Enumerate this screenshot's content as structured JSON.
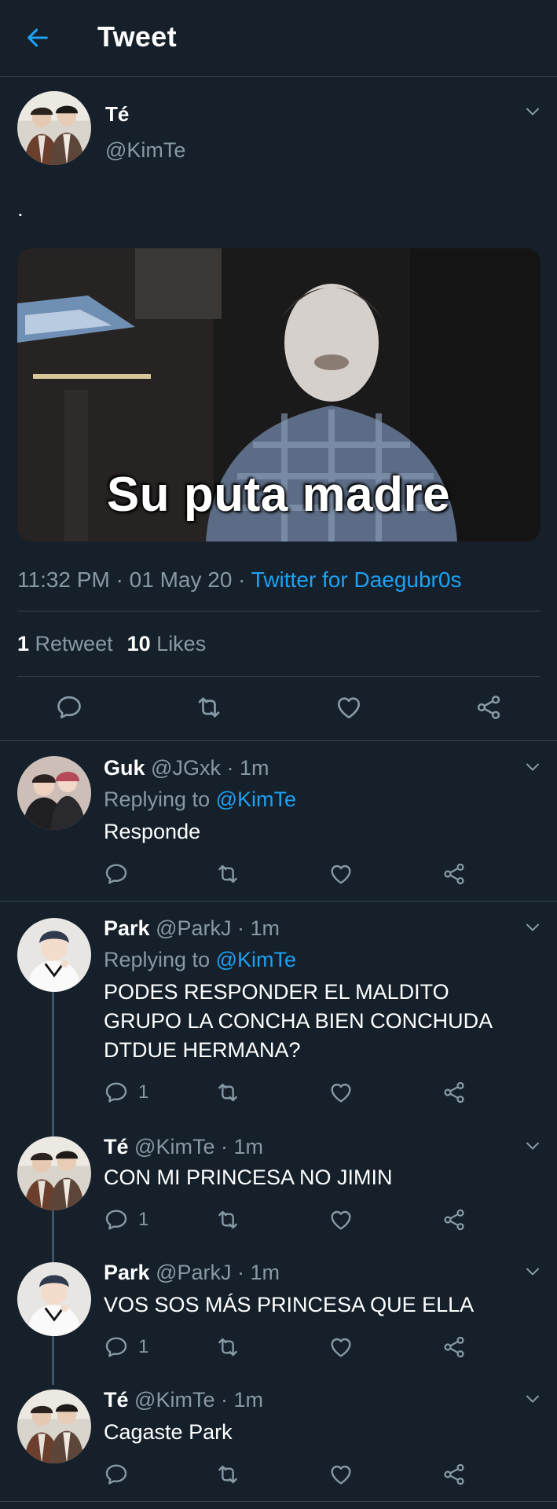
{
  "header": {
    "title": "Tweet"
  },
  "tweet": {
    "name": "Té",
    "handle": "@KimTe",
    "text": ".",
    "media_caption": "Su puta madre",
    "time": "11:32 PM · 01 May 20 · ",
    "source": "Twitter for Daegubr0s",
    "retweets_count": "1",
    "retweets_label": "Retweet",
    "likes_count": "10",
    "likes_label": "Likes"
  },
  "replies": [
    {
      "name": "Guk",
      "handle": "@JGxk",
      "time": " · 1m",
      "replying_prefix": "Replying to ",
      "replying_to": "@KimTe",
      "text": "Responde",
      "reply_count": ""
    },
    {
      "name": "Park",
      "handle": "@ParkJ",
      "time": " · 1m",
      "replying_prefix": "Replying to ",
      "replying_to": "@KimTe",
      "text": "PODES RESPONDER EL MALDITO GRUPO LA CONCHA BIEN CONCHUDA DTDUE HERMANA?",
      "reply_count": "1"
    },
    {
      "name": "Té",
      "handle": "@KimTe",
      "time": " · 1m",
      "text": "CON MI PRINCESA NO JIMIN",
      "reply_count": "1"
    },
    {
      "name": "Park",
      "handle": "@ParkJ",
      "time": " · 1m",
      "text": "VOS SOS MÁS PRINCESA QUE ELLA",
      "reply_count": "1"
    },
    {
      "name": "Té",
      "handle": "@KimTe",
      "time": " · 1m",
      "text": "Cagaste Park",
      "reply_count": ""
    }
  ],
  "colors": {
    "background": "#15202b",
    "accent": "#1da1f2",
    "secondary_text": "#8899a6",
    "divider": "#38444d"
  },
  "icons": [
    "back-arrow-icon",
    "chevron-down-icon",
    "reply-icon",
    "retweet-icon",
    "like-icon",
    "share-icon"
  ]
}
